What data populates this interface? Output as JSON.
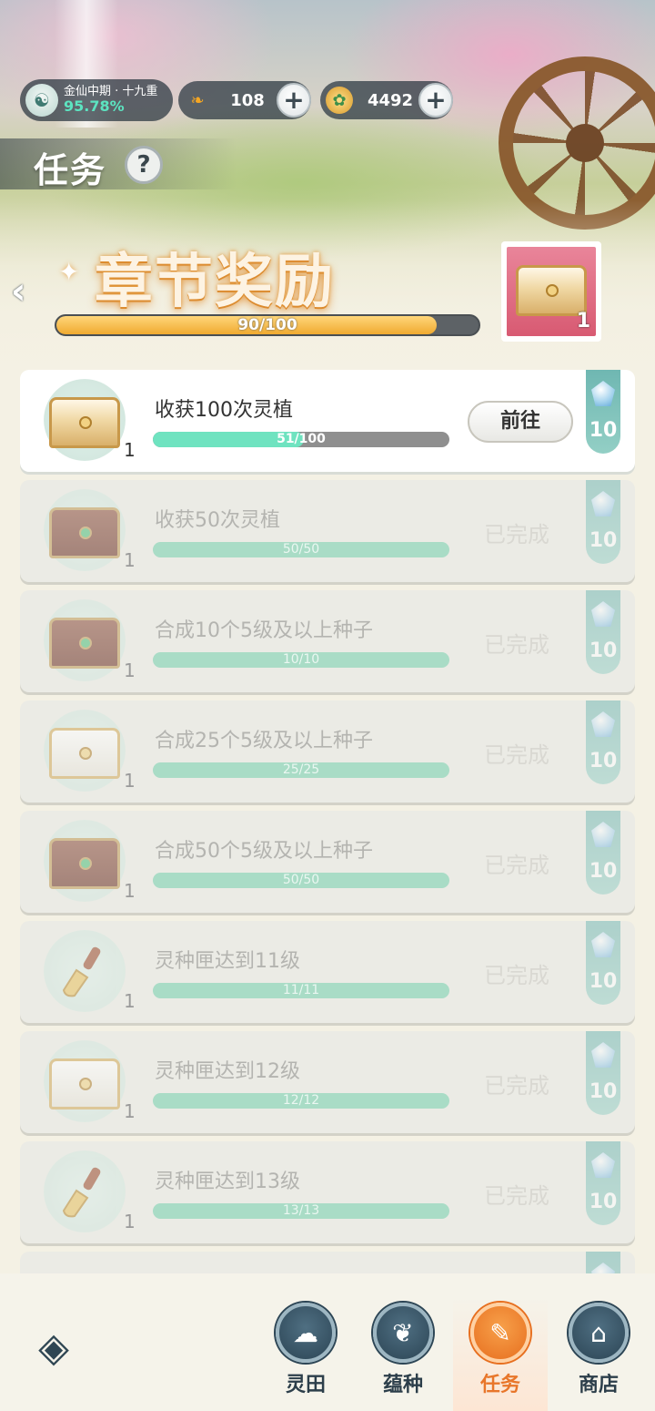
{
  "status": {
    "cultivation_name": "金仙中期 · 十九重",
    "cultivation_percent": "95.78%",
    "currency_a": {
      "icon": "flame-feather-icon",
      "value": "108",
      "plus": "+"
    },
    "currency_b": {
      "icon": "spirit-coin-icon",
      "value": "4492",
      "plus": "+"
    }
  },
  "header": {
    "title": "任务",
    "help": "?"
  },
  "chapter": {
    "back": "‹",
    "sparkle": "✦",
    "title": "章节奖励",
    "progress_current": 90,
    "progress_total": 100,
    "progress_text": "90/100",
    "chest_count": "1"
  },
  "tasks": [
    {
      "label": "收获100次灵植",
      "progress_text": "51/100",
      "progress": 0.51,
      "icon_count": "1",
      "action": "前往",
      "reward": "10",
      "icon": "gold-chest"
    },
    {
      "label": "收获50次灵植",
      "progress_text": "50/50",
      "progress": 1,
      "icon_count": "1",
      "action": "已完成",
      "reward": "10",
      "icon": "red-chest"
    },
    {
      "label": "合成10个5级及以上种子",
      "progress_text": "10/10",
      "progress": 1,
      "icon_count": "1",
      "action": "已完成",
      "reward": "10",
      "icon": "red-chest"
    },
    {
      "label": "合成25个5级及以上种子",
      "progress_text": "25/25",
      "progress": 1,
      "icon_count": "1",
      "action": "已完成",
      "reward": "10",
      "icon": "white-chest"
    },
    {
      "label": "合成50个5级及以上种子",
      "progress_text": "50/50",
      "progress": 1,
      "icon_count": "1",
      "action": "已完成",
      "reward": "10",
      "icon": "red-chest"
    },
    {
      "label": "灵种匣达到11级",
      "progress_text": "11/11",
      "progress": 1,
      "icon_count": "1",
      "action": "已完成",
      "reward": "10",
      "icon": "shovel"
    },
    {
      "label": "灵种匣达到12级",
      "progress_text": "12/12",
      "progress": 1,
      "icon_count": "1",
      "action": "已完成",
      "reward": "10",
      "icon": "white-chest"
    },
    {
      "label": "灵种匣达到13级",
      "progress_text": "13/13",
      "progress": 1,
      "icon_count": "1",
      "action": "已完成",
      "reward": "10",
      "icon": "shovel"
    }
  ],
  "nav": {
    "items": [
      {
        "label": "灵田",
        "icon": "spirit-field-icon",
        "glyph": "☁"
      },
      {
        "label": "蕴种",
        "icon": "seed-sprout-icon",
        "glyph": "❦"
      },
      {
        "label": "任务",
        "icon": "task-scroll-icon",
        "glyph": "✎"
      },
      {
        "label": "商店",
        "icon": "shop-icon",
        "glyph": "⌂"
      }
    ],
    "active": 2,
    "logo": "◈"
  },
  "colors": {
    "accent_orange": "#e8762a",
    "progress_teal": "#6fe3c0",
    "chapter_gold": "#f0aa30"
  }
}
